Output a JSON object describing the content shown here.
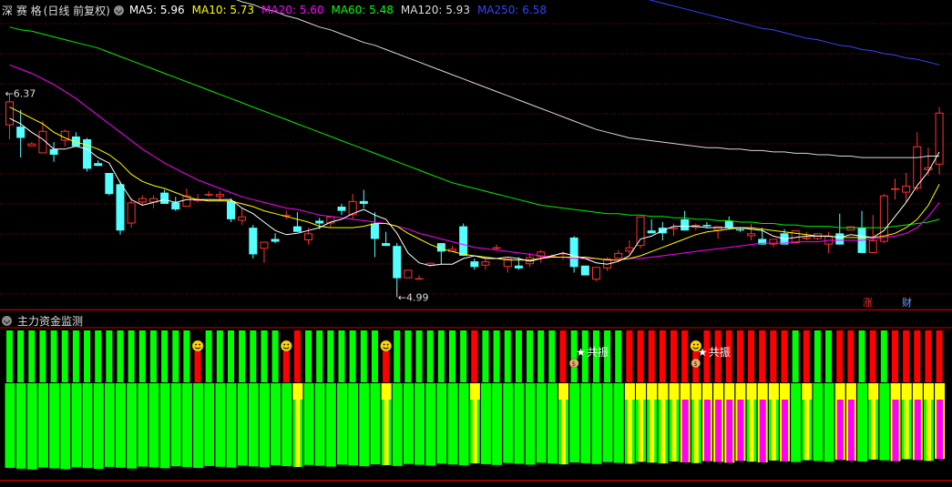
{
  "header": {
    "stock_name": "深 赛 格",
    "period_label": "(日线 前复权)",
    "ma5": {
      "label": "MA5:",
      "value": "5.96",
      "color": "#ffffff"
    },
    "ma10": {
      "label": "MA10:",
      "value": "5.73",
      "color": "#ffff00"
    },
    "ma20": {
      "label": "MA20:",
      "value": "5.60",
      "color": "#ff00ff"
    },
    "ma60": {
      "label": "MA60:",
      "value": "5.48",
      "color": "#00ff00"
    },
    "ma120": {
      "label": "MA120:",
      "value": "5.93",
      "color": "#dddddd"
    },
    "ma250": {
      "label": "MA250:",
      "value": "6.58",
      "color": "#3344ff"
    }
  },
  "price_annotations": {
    "high_label": "6.37",
    "low_label": "4.99"
  },
  "markers": {
    "zhang": "涨",
    "cai": "财"
  },
  "sub_panel": {
    "title": "主力资金监测",
    "resonance_label": "共振"
  },
  "colors": {
    "up": "#ff3232",
    "down": "#54ffff",
    "grid": "#7a0000",
    "panel_border": "#c00000",
    "green_bar": "#00ff00",
    "red_bar": "#ff0000",
    "yellow_bar": "#ffff00",
    "magenta_bar": "#ff00ff"
  },
  "chart_data": {
    "type": "candlestick",
    "ylim": [
      4.85,
      6.9
    ],
    "candles": [
      [
        6.15,
        6.37,
        6.05,
        6.32
      ],
      [
        6.14,
        6.26,
        5.92,
        6.06
      ],
      [
        6.0,
        6.03,
        6.0,
        6.02
      ],
      [
        5.95,
        6.18,
        5.95,
        6.11
      ],
      [
        5.98,
        6.03,
        5.89,
        5.94
      ],
      [
        6.04,
        6.12,
        6.0,
        6.11
      ],
      [
        6.07,
        6.1,
        6.0,
        6.0
      ],
      [
        6.05,
        6.06,
        5.82,
        5.84
      ],
      [
        5.88,
        5.9,
        5.86,
        5.86
      ],
      [
        5.81,
        5.81,
        5.65,
        5.66
      ],
      [
        5.73,
        5.75,
        5.37,
        5.4
      ],
      [
        5.45,
        5.63,
        5.42,
        5.6
      ],
      [
        5.6,
        5.65,
        5.58,
        5.63
      ],
      [
        5.6,
        5.65,
        5.56,
        5.63
      ],
      [
        5.67,
        5.69,
        5.59,
        5.59
      ],
      [
        5.6,
        5.64,
        5.54,
        5.55
      ],
      [
        5.57,
        5.7,
        5.57,
        5.65
      ],
      [
        5.62,
        5.66,
        5.6,
        5.62
      ],
      [
        5.65,
        5.68,
        5.64,
        5.66
      ],
      [
        5.64,
        5.68,
        5.61,
        5.66
      ],
      [
        5.61,
        5.63,
        5.46,
        5.48
      ],
      [
        5.47,
        5.56,
        5.44,
        5.5
      ],
      [
        5.42,
        5.44,
        5.2,
        5.23
      ],
      [
        5.27,
        5.3,
        5.17,
        5.32
      ],
      [
        5.34,
        5.38,
        5.31,
        5.32
      ],
      [
        5.5,
        5.54,
        5.48,
        5.51
      ],
      [
        5.43,
        5.53,
        5.39,
        5.39
      ],
      [
        5.33,
        5.42,
        5.3,
        5.38
      ],
      [
        5.47,
        5.49,
        5.41,
        5.45
      ],
      [
        5.45,
        5.5,
        5.42,
        5.5
      ],
      [
        5.57,
        5.59,
        5.51,
        5.54
      ],
      [
        5.51,
        5.66,
        5.48,
        5.61
      ],
      [
        5.61,
        5.69,
        5.56,
        5.59
      ],
      [
        5.45,
        5.53,
        5.21,
        5.34
      ],
      [
        5.31,
        5.39,
        5.29,
        5.29
      ],
      [
        5.29,
        5.31,
        4.99,
        5.06
      ],
      [
        5.06,
        5.07,
        5.07,
        5.12
      ],
      [
        5.06,
        5.08,
        5.05,
        5.06
      ],
      [
        5.15,
        5.17,
        5.14,
        5.17
      ],
      [
        5.31,
        5.31,
        5.16,
        5.25
      ],
      [
        5.25,
        5.29,
        5.25,
        5.27
      ],
      [
        5.43,
        5.45,
        5.22,
        5.22
      ],
      [
        5.18,
        5.2,
        5.12,
        5.14
      ],
      [
        5.15,
        5.2,
        5.12,
        5.18
      ],
      [
        5.28,
        5.3,
        5.26,
        5.28
      ],
      [
        5.14,
        5.2,
        5.1,
        5.2
      ],
      [
        5.15,
        5.21,
        5.12,
        5.13
      ],
      [
        5.16,
        5.24,
        5.14,
        5.21
      ],
      [
        5.21,
        5.26,
        5.17,
        5.25
      ],
      [
        5.22,
        5.23,
        5.22,
        5.22
      ],
      [
        5.23,
        5.25,
        5.19,
        5.24
      ],
      [
        5.35,
        5.36,
        5.1,
        5.14
      ],
      [
        5.15,
        5.14,
        5.08,
        5.08
      ],
      [
        5.05,
        5.14,
        5.04,
        5.14
      ],
      [
        5.13,
        5.21,
        5.11,
        5.2
      ],
      [
        5.2,
        5.26,
        5.2,
        5.24
      ],
      [
        5.25,
        5.33,
        5.23,
        5.28
      ],
      [
        5.29,
        5.5,
        5.27,
        5.5
      ],
      [
        5.4,
        5.48,
        5.38,
        5.38
      ],
      [
        5.42,
        5.46,
        5.33,
        5.38
      ],
      [
        5.41,
        5.45,
        5.36,
        5.42
      ],
      [
        5.48,
        5.54,
        5.4,
        5.4
      ],
      [
        5.42,
        5.45,
        5.4,
        5.44
      ],
      [
        5.44,
        5.46,
        5.42,
        5.43
      ],
      [
        5.4,
        5.43,
        5.34,
        5.43
      ],
      [
        5.47,
        5.5,
        5.41,
        5.42
      ],
      [
        5.41,
        5.42,
        5.39,
        5.4
      ],
      [
        5.36,
        5.45,
        5.33,
        5.38
      ],
      [
        5.34,
        5.42,
        5.3,
        5.3
      ],
      [
        5.3,
        5.34,
        5.28,
        5.34
      ],
      [
        5.38,
        5.41,
        5.3,
        5.3
      ],
      [
        5.31,
        5.4,
        5.32,
        5.4
      ],
      [
        5.34,
        5.39,
        5.33,
        5.35
      ],
      [
        5.34,
        5.38,
        5.33,
        5.38
      ],
      [
        5.3,
        5.39,
        5.24,
        5.36
      ],
      [
        5.38,
        5.52,
        5.3,
        5.3
      ],
      [
        5.4,
        5.43,
        5.4,
        5.43
      ],
      [
        5.42,
        5.54,
        5.24,
        5.24
      ],
      [
        5.24,
        5.51,
        5.24,
        5.33
      ],
      [
        5.32,
        5.66,
        5.31,
        5.65
      ],
      [
        5.69,
        5.77,
        5.62,
        5.7
      ],
      [
        5.67,
        5.81,
        5.6,
        5.72
      ],
      [
        5.7,
        6.1,
        5.68,
        6.0
      ],
      [
        5.83,
        5.99,
        5.79,
        5.85
      ],
      [
        5.87,
        6.28,
        5.8,
        6.24
      ]
    ],
    "ma5": [
      6.2,
      6.16,
      6.1,
      6.05,
      5.98,
      5.98,
      6.0,
      5.98,
      5.92,
      5.88,
      5.74,
      5.62,
      5.58,
      5.6,
      5.62,
      5.6,
      5.62,
      5.62,
      5.62,
      5.62,
      5.62,
      5.56,
      5.52,
      5.46,
      5.4,
      5.37,
      5.38,
      5.4,
      5.42,
      5.46,
      5.48,
      5.52,
      5.55,
      5.51,
      5.48,
      5.38,
      5.24,
      5.17,
      5.15,
      5.16,
      5.16,
      5.2,
      5.22,
      5.2,
      5.2,
      5.21,
      5.2,
      5.18,
      5.2,
      5.22,
      5.24,
      5.22,
      5.2,
      5.17,
      5.16,
      5.18,
      5.22,
      5.34,
      5.36,
      5.4,
      5.43,
      5.43,
      5.43,
      5.42,
      5.42,
      5.42,
      5.42,
      5.41,
      5.4,
      5.36,
      5.34,
      5.35,
      5.36,
      5.36,
      5.36,
      5.35,
      5.37,
      5.36,
      5.35,
      5.4,
      5.5,
      5.6,
      5.72,
      5.82,
      5.96
    ],
    "ma10": [
      6.28,
      6.24,
      6.2,
      6.16,
      6.1,
      6.06,
      6.03,
      6.01,
      5.98,
      5.94,
      5.88,
      5.8,
      5.75,
      5.72,
      5.7,
      5.67,
      5.64,
      5.62,
      5.61,
      5.61,
      5.61,
      5.59,
      5.57,
      5.54,
      5.52,
      5.5,
      5.48,
      5.46,
      5.43,
      5.42,
      5.42,
      5.42,
      5.43,
      5.45,
      5.45,
      5.43,
      5.38,
      5.34,
      5.3,
      5.27,
      5.25,
      5.23,
      5.22,
      5.21,
      5.2,
      5.19,
      5.19,
      5.19,
      5.2,
      5.21,
      5.21,
      5.21,
      5.21,
      5.2,
      5.19,
      5.19,
      5.2,
      5.22,
      5.25,
      5.28,
      5.31,
      5.34,
      5.37,
      5.39,
      5.4,
      5.41,
      5.42,
      5.42,
      5.41,
      5.4,
      5.39,
      5.38,
      5.37,
      5.36,
      5.36,
      5.35,
      5.35,
      5.35,
      5.35,
      5.36,
      5.38,
      5.42,
      5.48,
      5.58,
      5.73
    ],
    "ma20": [
      6.58,
      6.55,
      6.52,
      6.48,
      6.44,
      6.39,
      6.34,
      6.28,
      6.22,
      6.16,
      6.1,
      6.04,
      5.98,
      5.93,
      5.88,
      5.84,
      5.8,
      5.76,
      5.73,
      5.7,
      5.67,
      5.64,
      5.62,
      5.6,
      5.58,
      5.56,
      5.55,
      5.53,
      5.51,
      5.5,
      5.49,
      5.48,
      5.47,
      5.46,
      5.45,
      5.43,
      5.41,
      5.38,
      5.36,
      5.34,
      5.32,
      5.3,
      5.28,
      5.27,
      5.26,
      5.25,
      5.24,
      5.23,
      5.22,
      5.21,
      5.21,
      5.2,
      5.2,
      5.2,
      5.19,
      5.19,
      5.2,
      5.2,
      5.21,
      5.22,
      5.23,
      5.24,
      5.25,
      5.26,
      5.27,
      5.28,
      5.29,
      5.3,
      5.31,
      5.31,
      5.31,
      5.32,
      5.32,
      5.32,
      5.33,
      5.33,
      5.33,
      5.33,
      5.34,
      5.35,
      5.36,
      5.38,
      5.42,
      5.5,
      5.6
    ],
    "ma60": [
      6.85,
      6.83,
      6.82,
      6.8,
      6.78,
      6.76,
      6.74,
      6.72,
      6.7,
      6.67,
      6.64,
      6.61,
      6.58,
      6.55,
      6.52,
      6.49,
      6.46,
      6.43,
      6.4,
      6.37,
      6.34,
      6.31,
      6.28,
      6.25,
      6.22,
      6.19,
      6.16,
      6.13,
      6.1,
      6.07,
      6.04,
      6.01,
      5.98,
      5.95,
      5.92,
      5.89,
      5.86,
      5.83,
      5.8,
      5.77,
      5.74,
      5.72,
      5.7,
      5.68,
      5.66,
      5.64,
      5.62,
      5.6,
      5.58,
      5.57,
      5.56,
      5.55,
      5.54,
      5.53,
      5.52,
      5.52,
      5.51,
      5.51,
      5.5,
      5.5,
      5.49,
      5.49,
      5.48,
      5.48,
      5.47,
      5.47,
      5.46,
      5.46,
      5.45,
      5.45,
      5.44,
      5.44,
      5.43,
      5.43,
      5.43,
      5.42,
      5.42,
      5.42,
      5.42,
      5.42,
      5.43,
      5.44,
      5.45,
      5.46,
      5.48
    ],
    "ma120": [
      7.55,
      7.52,
      7.5,
      7.47,
      7.45,
      7.42,
      7.4,
      7.38,
      7.35,
      7.33,
      7.3,
      7.28,
      7.26,
      7.23,
      7.21,
      7.18,
      7.16,
      7.13,
      7.11,
      7.08,
      7.06,
      7.03,
      7.01,
      6.98,
      6.96,
      6.93,
      6.91,
      6.88,
      6.85,
      6.83,
      6.8,
      6.77,
      6.74,
      6.72,
      6.69,
      6.66,
      6.63,
      6.6,
      6.57,
      6.54,
      6.51,
      6.48,
      6.45,
      6.42,
      6.39,
      6.36,
      6.33,
      6.3,
      6.27,
      6.24,
      6.21,
      6.18,
      6.15,
      6.12,
      6.1,
      6.08,
      6.06,
      6.05,
      6.04,
      6.03,
      6.02,
      6.01,
      6.0,
      5.99,
      5.99,
      5.98,
      5.98,
      5.97,
      5.97,
      5.96,
      5.96,
      5.95,
      5.95,
      5.94,
      5.94,
      5.93,
      5.93,
      5.92,
      5.92,
      5.92,
      5.92,
      5.92,
      5.92,
      5.93,
      5.93
    ],
    "ma250": [
      8.55,
      8.54,
      8.52,
      8.51,
      8.49,
      8.47,
      8.46,
      8.44,
      8.42,
      8.4,
      8.38,
      8.36,
      8.34,
      8.31,
      8.29,
      8.27,
      8.24,
      8.22,
      8.19,
      8.16,
      8.14,
      8.11,
      8.08,
      8.05,
      8.02,
      7.99,
      7.96,
      7.93,
      7.9,
      7.87,
      7.84,
      7.81,
      7.78,
      7.75,
      7.72,
      7.69,
      7.66,
      7.63,
      7.6,
      7.57,
      7.54,
      7.51,
      7.48,
      7.45,
      7.42,
      7.39,
      7.36,
      7.33,
      7.3,
      7.27,
      7.24,
      7.21,
      7.18,
      7.15,
      7.12,
      7.1,
      7.08,
      7.06,
      7.04,
      7.02,
      7.0,
      6.98,
      6.96,
      6.94,
      6.92,
      6.9,
      6.88,
      6.86,
      6.84,
      6.83,
      6.81,
      6.79,
      6.77,
      6.76,
      6.74,
      6.72,
      6.71,
      6.69,
      6.68,
      6.66,
      6.65,
      6.63,
      6.62,
      6.6,
      6.58
    ]
  },
  "money_flow": {
    "bars": [
      "g",
      "g",
      "g",
      "g",
      "g",
      "g",
      "g",
      "g",
      "g",
      "g",
      "g",
      "g",
      "g",
      "g",
      "g",
      "g",
      "g",
      "g",
      "g",
      "g",
      "g",
      "g",
      "g",
      "g",
      "g",
      "g",
      "y",
      "g",
      "g",
      "g",
      "g",
      "g",
      "g",
      "g",
      "y",
      "g",
      "g",
      "g",
      "g",
      "g",
      "g",
      "g",
      "y",
      "g",
      "g",
      "g",
      "g",
      "g",
      "g",
      "g",
      "y",
      "g",
      "g",
      "g",
      "g",
      "g",
      "y",
      "y",
      "y",
      "y",
      "y",
      "m",
      "y",
      "m",
      "m",
      "m",
      "m",
      "y",
      "m",
      "y",
      "m",
      "g",
      "y",
      "g",
      "g",
      "m",
      "m",
      "g",
      "y",
      "g",
      "m",
      "y",
      "m",
      "y",
      "m"
    ],
    "smiley_bars": [
      17,
      25,
      34,
      62
    ],
    "resonance_bars": [
      51,
      62
    ],
    "zhang_bar": 80,
    "cai_bar": 83
  }
}
